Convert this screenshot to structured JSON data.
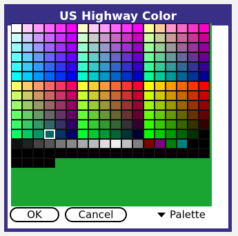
{
  "dialog": {
    "title": "US Highway Color"
  },
  "colors": {
    "frame": "#3a2f86",
    "palette_bg": "#1aa533",
    "selected_outline": "#ffffff"
  },
  "palette": {
    "columns": 18,
    "selected_index": 201,
    "rows": [
      [
        "#ffffff",
        "#ffccff",
        "#ff99ff",
        "#ff66ff",
        "#ff33ff",
        "#ff00ff",
        "#ffffcc",
        "#ffccff",
        "#ff99ff",
        "#ff66ff",
        "#ff33ff",
        "#ff00ff",
        "#ffff99",
        "#ffcc99",
        "#ff99cc",
        "#ff66cc",
        "#ff33cc",
        "#ff00cc"
      ],
      [
        "#ccffff",
        "#ccccff",
        "#cc99ff",
        "#cc66ff",
        "#cc33ff",
        "#cc00ff",
        "#ccffcc",
        "#cccccc",
        "#cc99cc",
        "#cc66cc",
        "#cc33cc",
        "#cc00cc",
        "#ccff99",
        "#cccc99",
        "#cc9999",
        "#cc6699",
        "#cc3399",
        "#cc0099"
      ],
      [
        "#99ffff",
        "#99ccff",
        "#9999ff",
        "#9966ff",
        "#9933ff",
        "#9900ff",
        "#99ffcc",
        "#99cccc",
        "#9999cc",
        "#9966cc",
        "#9933cc",
        "#9900cc",
        "#99ff99",
        "#99cc99",
        "#999999",
        "#996699",
        "#993399",
        "#990099"
      ],
      [
        "#66ffff",
        "#66ccff",
        "#6699ff",
        "#6666ff",
        "#6633ff",
        "#6600ff",
        "#66ffcc",
        "#66cccc",
        "#6699cc",
        "#6666cc",
        "#6633cc",
        "#6600cc",
        "#66ff99",
        "#66cc99",
        "#669999",
        "#666699",
        "#663399",
        "#660099"
      ],
      [
        "#33ffff",
        "#33ccff",
        "#3399ff",
        "#3366ff",
        "#3333ff",
        "#3300ff",
        "#33ffcc",
        "#33cccc",
        "#3399cc",
        "#3366cc",
        "#3333cc",
        "#3300cc",
        "#33ff99",
        "#33cc99",
        "#339999",
        "#336699",
        "#333399",
        "#330099"
      ],
      [
        "#00ffff",
        "#00ccff",
        "#0099ff",
        "#0066ff",
        "#0033ff",
        "#0000ff",
        "#00ffcc",
        "#00cccc",
        "#0099cc",
        "#0066cc",
        "#0033cc",
        "#0000cc",
        "#00ff99",
        "#00cc99",
        "#009999",
        "#006699",
        "#003399",
        "#000099"
      ],
      [
        "#ffff66",
        "#ffcc66",
        "#ff9966",
        "#ff6666",
        "#ff3366",
        "#ff0066",
        "#ffff33",
        "#ffcc33",
        "#ff9933",
        "#ff6633",
        "#ff3333",
        "#ff0033",
        "#ffff00",
        "#ffcc00",
        "#ff9900",
        "#ff6600",
        "#ff3300",
        "#ff0000"
      ],
      [
        "#ccff66",
        "#cccc66",
        "#cc9966",
        "#cc6666",
        "#cc3366",
        "#cc0066",
        "#ccff33",
        "#cccc33",
        "#cc9933",
        "#cc6633",
        "#cc3333",
        "#cc0033",
        "#ccff00",
        "#cccc00",
        "#cc9900",
        "#cc6600",
        "#cc3300",
        "#cc0000"
      ],
      [
        "#99ff66",
        "#99cc66",
        "#999966",
        "#996666",
        "#993366",
        "#990066",
        "#99ff33",
        "#99cc33",
        "#999933",
        "#996633",
        "#993333",
        "#990033",
        "#99ff00",
        "#99cc00",
        "#999900",
        "#996600",
        "#993300",
        "#990000"
      ],
      [
        "#66ff66",
        "#66cc66",
        "#669966",
        "#666666",
        "#663366",
        "#660066",
        "#66ff33",
        "#66cc33",
        "#669933",
        "#666633",
        "#663333",
        "#660033",
        "#66ff00",
        "#66cc00",
        "#669900",
        "#666600",
        "#663300",
        "#660000"
      ],
      [
        "#33ff66",
        "#33cc66",
        "#339966",
        "#336666",
        "#333366",
        "#330066",
        "#33ff33",
        "#33cc33",
        "#339933",
        "#336633",
        "#333333",
        "#330033",
        "#33ff00",
        "#33cc00",
        "#339900",
        "#336600",
        "#333300",
        "#330000"
      ],
      [
        "#00ff66",
        "#00cc66",
        "#009966",
        "#006666",
        "#003366",
        "#000066",
        "#00ff33",
        "#00cc33",
        "#009933",
        "#006633",
        "#003333",
        "#000033",
        "#00ff00",
        "#00cc00",
        "#009900",
        "#006600",
        "#003300",
        "#000000"
      ],
      [
        "#111111",
        "#222222",
        "#444444",
        "#555555",
        "#777777",
        "#888888",
        "#aaaaaa",
        "#bbbbbb",
        "#dddddd",
        "#eeeeee",
        "#c0c0c0",
        "#808080",
        "#800000",
        "#800080",
        "#008000",
        "#008080",
        "#000000",
        "#000000"
      ],
      [
        "#000000",
        "#000000",
        "#000000",
        "#000000",
        "#000000",
        "#000000",
        "#000000",
        "#000000",
        "#000000",
        "#000000",
        "#000000",
        "#000000",
        "#000000",
        "#000000",
        "#000000",
        "#000000",
        "#000000",
        "#000000"
      ],
      [
        "#000000",
        "#000000",
        "#000000",
        "#000000"
      ]
    ]
  },
  "buttons": {
    "ok_label": "OK",
    "cancel_label": "Cancel"
  },
  "picker": {
    "label": "Palette",
    "icon": "triangle-down-icon"
  }
}
